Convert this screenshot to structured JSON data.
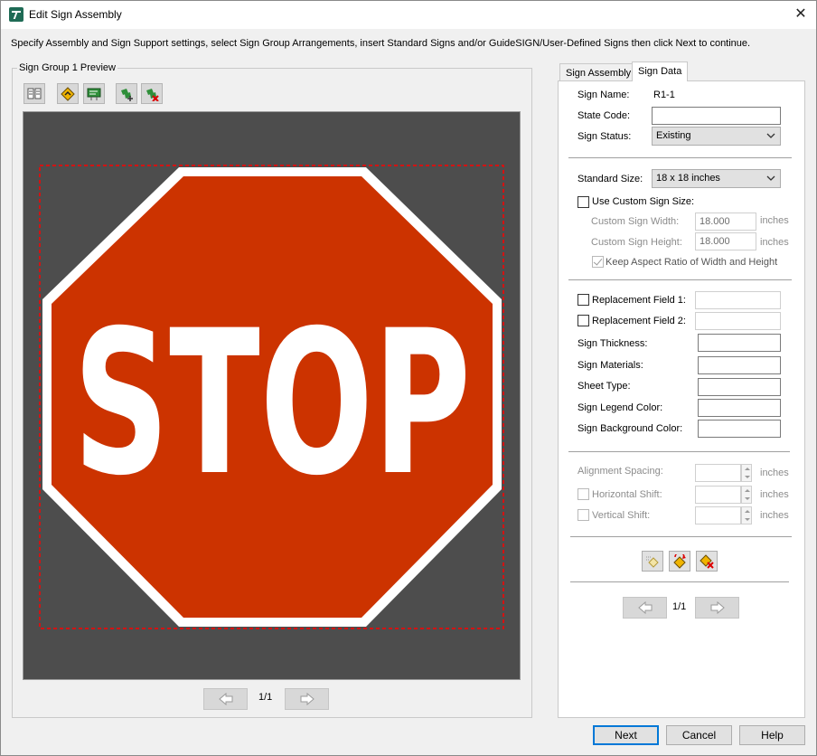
{
  "window": {
    "title": "Edit Sign Assembly",
    "close_glyph": "✕",
    "instructions": "Specify Assembly and Sign Support settings, select Sign Group Arrangements, insert Standard Signs and/or GuideSIGN/User-Defined Signs then click Next to continue."
  },
  "preview": {
    "group_title": "Sign Group 1 Preview",
    "toolbar_icons": [
      "sign-layout-icon",
      "insert-standard-sign-icon",
      "insert-guide-sign-icon",
      "add-sign-icon",
      "delete-sign-icon"
    ],
    "sign_legend": "STOP",
    "colors": {
      "background": "#4d4d4d",
      "sign_red": "#cc3300",
      "border_white": "#ffffff",
      "selection": "#ff0000"
    },
    "page_indicator": "1/1"
  },
  "tabs": [
    {
      "label": "Sign Assembly",
      "active": false
    },
    {
      "label": "Sign Data",
      "active": true
    }
  ],
  "sign_data": {
    "sign_name_label": "Sign Name:",
    "sign_name_value": "R1-1",
    "state_code_label": "State Code:",
    "state_code_value": "",
    "sign_status_label": "Sign Status:",
    "sign_status_value": "Existing",
    "standard_size_label": "Standard Size:",
    "standard_size_value": "18 x 18 inches",
    "use_custom_size_label": "Use Custom Sign Size:",
    "custom_width_label": "Custom Sign Width:",
    "custom_width_value": "18.000",
    "custom_height_label": "Custom Sign Height:",
    "custom_height_value": "18.000",
    "inches": "inches",
    "keep_aspect_label": "Keep Aspect Ratio of Width and Height",
    "replacement_field_1_label": "Replacement Field 1:",
    "replacement_field_2_label": "Replacement Field 2:",
    "sign_thickness_label": "Sign Thickness:",
    "sign_materials_label": "Sign Materials:",
    "sheet_type_label": "Sheet Type:",
    "sign_legend_color_label": "Sign Legend Color:",
    "sign_background_color_label": "Sign Background Color:",
    "alignment_spacing_label": "Alignment Spacing:",
    "horizontal_shift_label": "Horizontal Shift:",
    "vertical_shift_label": "Vertical Shift:",
    "page_indicator": "1/1"
  },
  "buttons": {
    "next": "Next",
    "cancel": "Cancel",
    "help": "Help"
  }
}
